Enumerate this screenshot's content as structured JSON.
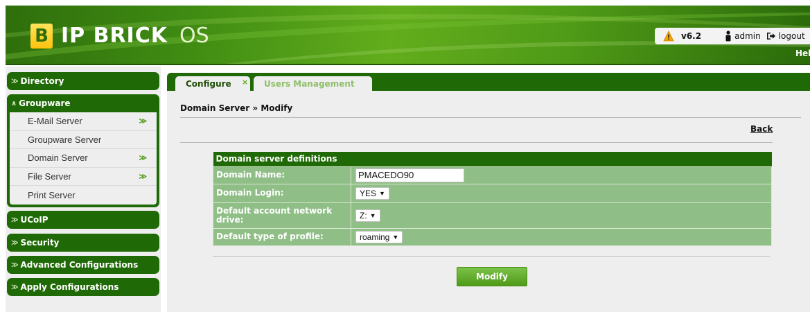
{
  "header": {
    "logo_mark": "B",
    "logo_text": "IP BRICK",
    "logo_suffix": "OS",
    "version": "v6.2",
    "user": "admin",
    "logout": "logout",
    "help": "Help"
  },
  "sidebar": {
    "directory": "Directory",
    "groupware": "Groupware",
    "groupware_items": [
      {
        "label": "E-Mail Server",
        "has_submenu": true
      },
      {
        "label": "Groupware Server",
        "has_submenu": false
      },
      {
        "label": "Domain Server",
        "has_submenu": true
      },
      {
        "label": "File Server",
        "has_submenu": true
      },
      {
        "label": "Print Server",
        "has_submenu": false
      }
    ],
    "ucoip": "UCoIP",
    "security": "Security",
    "advanced": "Advanced Configurations",
    "apply": "Apply Configurations"
  },
  "tabs": {
    "configure": "Configure",
    "close": "×",
    "users_management": "Users Management"
  },
  "main": {
    "title": "Domain Server » Modify",
    "back": "Back",
    "form_header": "Domain server definitions",
    "domain_name_label": "Domain Name:",
    "domain_name_value": "PMACEDO90",
    "domain_login_label": "Domain Login:",
    "domain_login_value": "YES",
    "network_drive_label": "Default account network drive:",
    "network_drive_value": "Z:",
    "profile_label": "Default type of profile:",
    "profile_value": "roaming",
    "modify_button": "Modify"
  },
  "colors": {
    "brand_dark_green": "#1f6a06",
    "brand_light_green": "#62ad1c",
    "form_row": "#8fbe86"
  }
}
